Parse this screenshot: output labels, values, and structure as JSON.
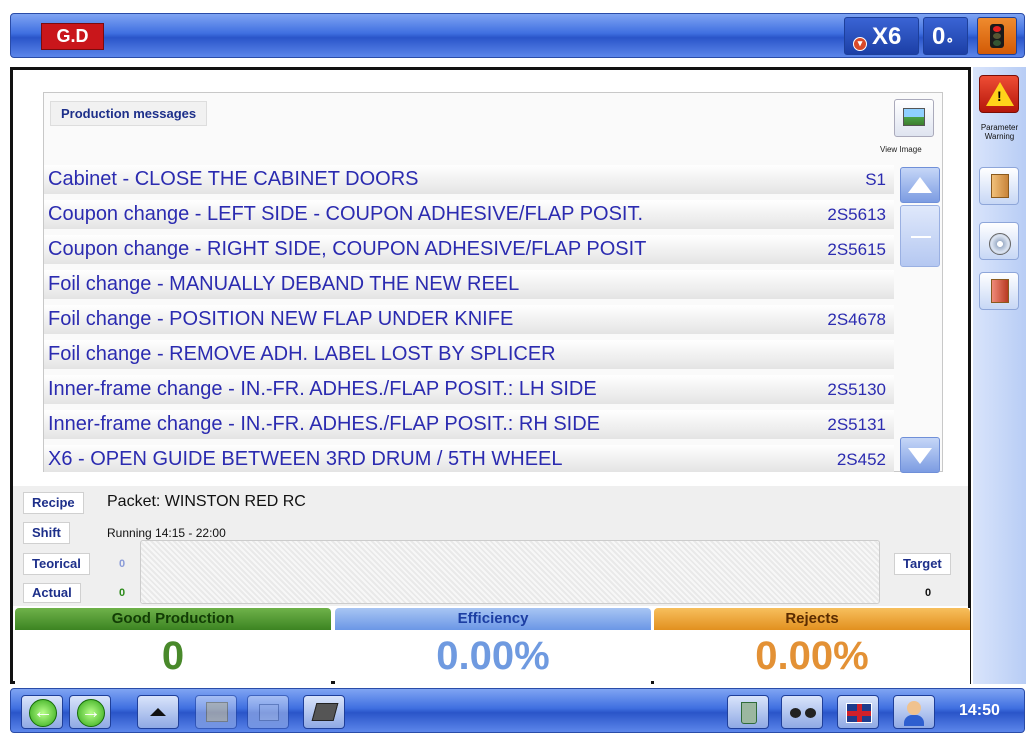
{
  "topbar": {
    "logo": "G.D",
    "machine": "X6",
    "counter": "0",
    "counter_suffix": "∘"
  },
  "messages": {
    "title": "Production messages",
    "view_image_label": "View Image",
    "rows": [
      {
        "text": "Cabinet - CLOSE THE CABINET DOORS",
        "code": "S1"
      },
      {
        "text": "Coupon change - LEFT SIDE - COUPON ADHESIVE/FLAP POSIT.",
        "code": "2S5613"
      },
      {
        "text": "Coupon change - RIGHT SIDE, COUPON ADHESIVE/FLAP POSIT",
        "code": "2S5615"
      },
      {
        "text": "Foil change - MANUALLY DEBAND THE NEW REEL",
        "code": ""
      },
      {
        "text": "Foil change - POSITION NEW FLAP UNDER KNIFE",
        "code": "2S4678"
      },
      {
        "text": "Foil change - REMOVE ADH. LABEL LOST BY SPLICER",
        "code": ""
      },
      {
        "text": "Inner-frame change - IN.-FR. ADHES./FLAP POSIT.: LH SIDE",
        "code": "2S5130"
      },
      {
        "text": "Inner-frame change - IN.-FR. ADHES./FLAP POSIT.: RH SIDE",
        "code": "2S5131"
      },
      {
        "text": "X6 - OPEN GUIDE BETWEEN 3RD DRUM / 5TH WHEEL",
        "code": "2S452"
      }
    ]
  },
  "info": {
    "recipe_label": "Recipe",
    "recipe_value": "Packet: WINSTON RED RC",
    "shift_label": "Shift",
    "shift_value": "Running 14:15 - 22:00",
    "teorical_label": "Teorical",
    "teorical_value": "0",
    "actual_label": "Actual",
    "actual_value": "0",
    "target_label": "Target",
    "target_value": "0"
  },
  "kpis": {
    "good_label": "Good Production",
    "good_value": "0",
    "efficiency_label": "Efficiency",
    "efficiency_value": "0.00%",
    "rejects_label": "Rejects",
    "rejects_value": "0.00%"
  },
  "rightcol": {
    "warning_label_1": "Parameter",
    "warning_label_2": "Warning"
  },
  "bottombar": {
    "clock": "14:50"
  },
  "colors": {
    "bar_blue": "#3f6fe0",
    "logo_red": "#c9161b",
    "good_green": "#49892b",
    "efficiency_blue": "#6f9ae0",
    "rejects_orange": "#e39135",
    "message_text": "#2b2bb0"
  }
}
